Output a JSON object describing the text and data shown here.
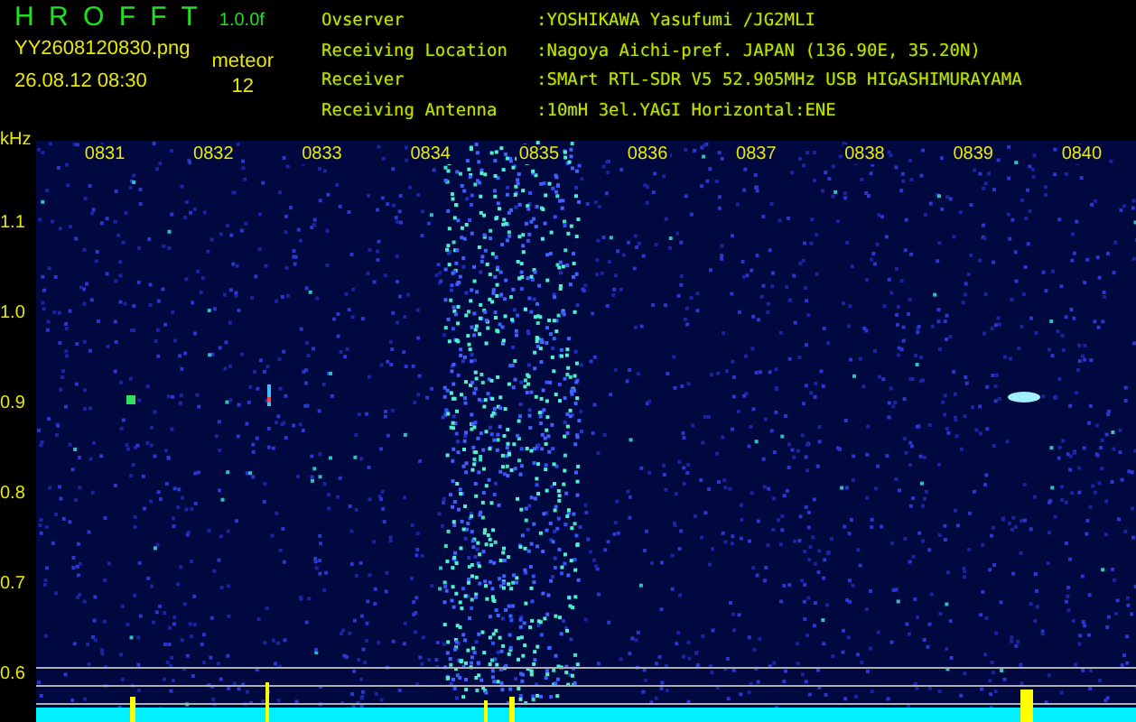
{
  "app": {
    "name": "H R O F F T",
    "version": "1.0.0f",
    "filename": "YY2608120830.png",
    "timestamp": "26.08.12 08:30",
    "count_label": "meteor",
    "count": "12"
  },
  "info": [
    {
      "label": "Ovserver",
      "value": ":YOSHIKAWA Yasufumi /JG2MLI"
    },
    {
      "label": "Receiving Location",
      "value": ":Nagoya Aichi-pref. JAPAN (136.90E, 35.20N)"
    },
    {
      "label": "Receiver",
      "value": ":SMArt RTL-SDR V5 52.905MHz USB HIGASHIMURAYAMA"
    },
    {
      "label": "Receiving Antenna",
      "value": ":10mH 3el.YAGI Horizontal:ENE"
    }
  ],
  "spectrogram": {
    "y_unit": "kHz",
    "y_labels": [
      "1.1",
      "1.0",
      "0.9",
      "0.8",
      "0.7",
      "0.6"
    ],
    "time_labels": [
      "0831",
      "0832",
      "0833",
      "0834",
      "0835",
      "0836",
      "0837",
      "0838",
      "0839",
      "0840"
    ]
  }
}
